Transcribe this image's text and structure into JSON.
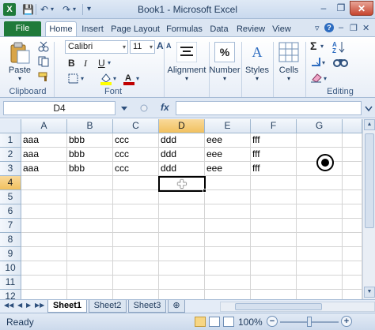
{
  "window": {
    "title": "Book1 - Microsoft Excel",
    "app_icon": "X"
  },
  "qat": {
    "save": "💾",
    "undo": "↶",
    "redo": "↷",
    "more": "▾"
  },
  "window_controls": {
    "minimize": "–",
    "maximize": "❐",
    "close": "✕"
  },
  "ribbon_tabs": [
    "File",
    "Home",
    "Insert",
    "Page Layout",
    "Formulas",
    "Data",
    "Review",
    "View"
  ],
  "ribbon_right": {
    "help": "?",
    "minimize": "▿",
    "restore": "❐",
    "close": "✕"
  },
  "ribbon": {
    "clipboard": {
      "label": "Clipboard",
      "paste": "Paste"
    },
    "font": {
      "label": "Font",
      "name": "Calibri",
      "size": "11",
      "bold": "B",
      "italic": "I",
      "underline": "U",
      "grow": "A",
      "shrink": "A",
      "fill_color": "#ffff00",
      "font_color": "#c00000"
    },
    "alignment": {
      "label": "Alignment"
    },
    "number": {
      "label": "Number",
      "icon": "%"
    },
    "styles": {
      "label": "Styles",
      "icon": "A"
    },
    "cells": {
      "label": "Cells"
    },
    "editing": {
      "label": "Editing",
      "sum": "Σ"
    }
  },
  "formula_bar": {
    "name_box": "D4",
    "fx": "fx",
    "value": ""
  },
  "columns": [
    "A",
    "B",
    "C",
    "D",
    "E",
    "F",
    "G"
  ],
  "rows": [
    "1",
    "2",
    "3",
    "4",
    "5",
    "6",
    "7",
    "8",
    "9",
    "10",
    "11",
    "12"
  ],
  "cells": [
    [
      "aaa",
      "bbb",
      "ccc",
      "ddd",
      "eee",
      "fff",
      ""
    ],
    [
      "aaa",
      "bbb",
      "ccc",
      "ddd",
      "eee",
      "fff",
      ""
    ],
    [
      "aaa",
      "bbb",
      "ccc",
      "ddd",
      "eee",
      "fff",
      ""
    ]
  ],
  "selection": {
    "column": "D",
    "row": "4"
  },
  "sheets": [
    "Sheet1",
    "Sheet2",
    "Sheet3"
  ],
  "sheet_nav": {
    "first": "◀◀",
    "prev": "◀",
    "next": "▶",
    "last": "▶▶",
    "new_sheet": "⊕"
  },
  "status": {
    "text": "Ready",
    "zoom": "100%",
    "zoom_out": "−",
    "zoom_in": "+"
  },
  "scrollbar": {
    "up": "▲",
    "down": "▼"
  }
}
